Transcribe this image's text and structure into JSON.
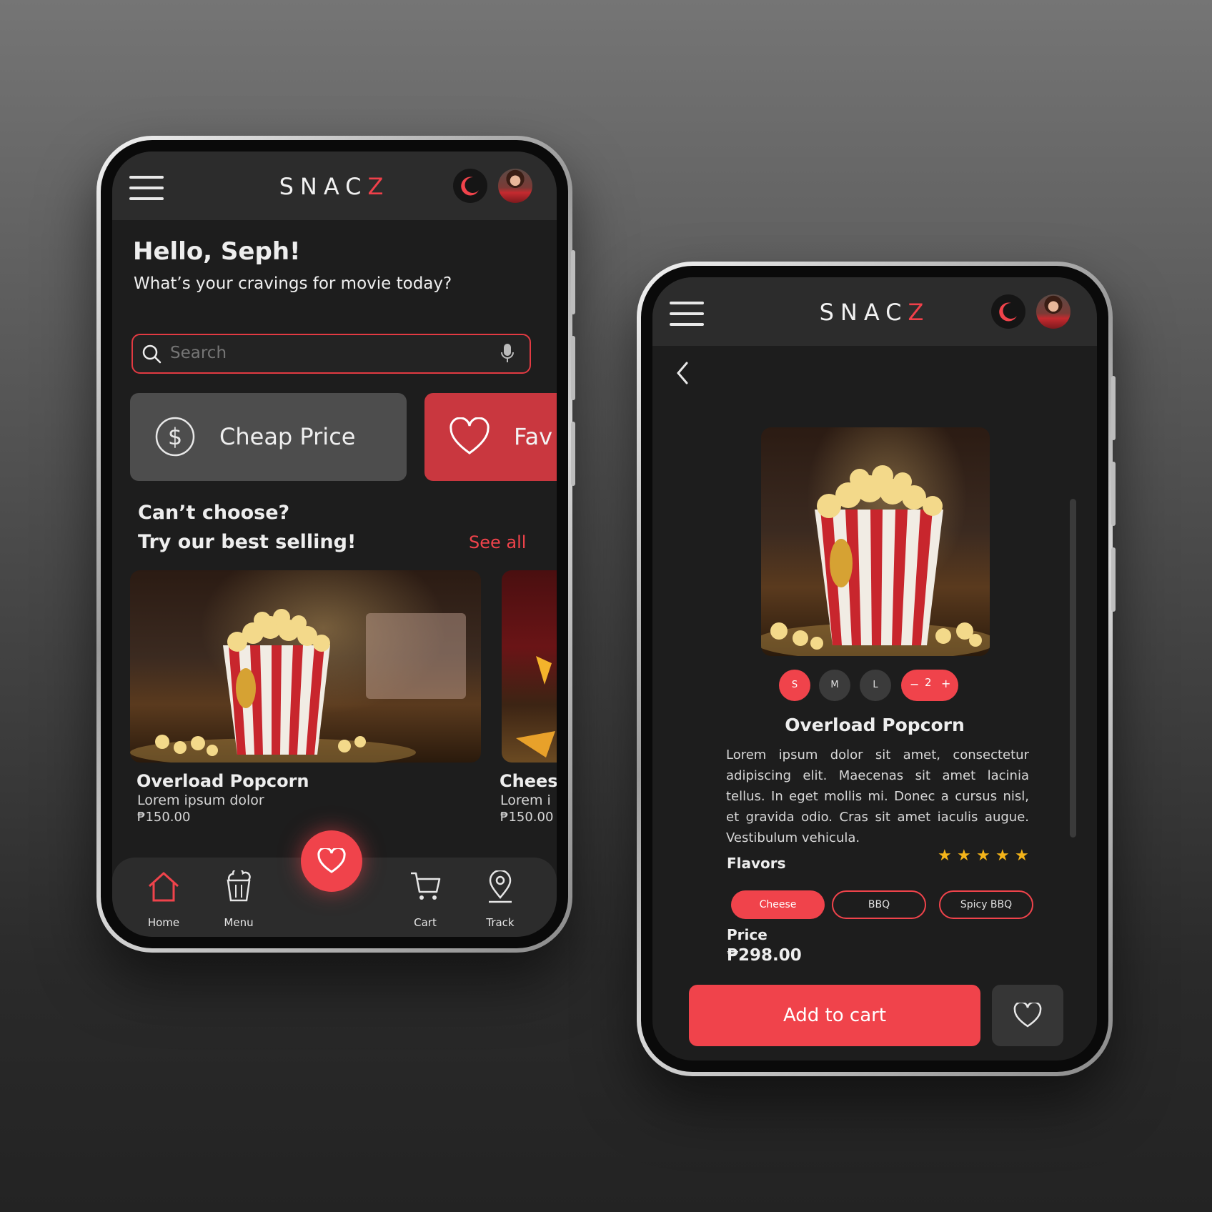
{
  "app": {
    "logo_main": "SNAC",
    "logo_accent": "Z"
  },
  "colors": {
    "accent": "#f0434b",
    "bg": "#1d1d1d",
    "appbar": "#2c2c2c",
    "star": "#f4b41a"
  },
  "home": {
    "greeting": "Hello, Seph!",
    "subtitle": "What’s your cravings for movie today?",
    "search": {
      "placeholder": "Search"
    },
    "quick_filters": [
      {
        "label": "Cheap Price",
        "icon": "dollar-icon"
      },
      {
        "label": "Fav",
        "icon": "heart-icon"
      }
    ],
    "section": {
      "line1": "Can’t choose?",
      "line2": "Try our best selling!",
      "see_all": "See all"
    },
    "products": [
      {
        "name": "Overload Popcorn",
        "desc": "Lorem ipsum dolor",
        "price": "₱150.00"
      },
      {
        "name": "Chees",
        "desc": "Lorem i",
        "price": "₱150.00"
      }
    ],
    "nav": [
      {
        "label": "Home",
        "icon": "home-icon"
      },
      {
        "label": "Menu",
        "icon": "popcorn-icon"
      },
      {
        "label": "Cart",
        "icon": "cart-icon"
      },
      {
        "label": "Track",
        "icon": "location-pin-icon"
      }
    ]
  },
  "detail": {
    "sizes": [
      "S",
      "M",
      "L"
    ],
    "selected_size": "S",
    "quantity": "2",
    "title": "Overload Popcorn",
    "description": "Lorem ipsum dolor sit amet, consectetur adipiscing elit. Maecenas sit amet lacinia tellus. In eget mollis mi. Donec a cursus nisl, et gravida odio. Cras sit amet iaculis augue. Vestibulum vehicula.",
    "rating": 5,
    "flavors_label": "Flavors",
    "flavors": [
      "Cheese",
      "BBQ",
      "Spicy BBQ"
    ],
    "selected_flavor": "Cheese",
    "price_label": "Price",
    "price": "₱298.00",
    "add_to_cart": "Add to cart"
  }
}
